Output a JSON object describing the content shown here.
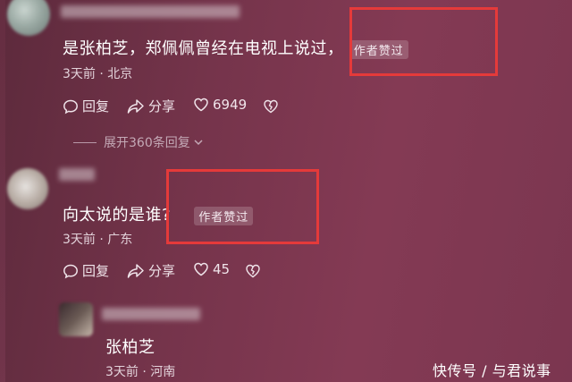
{
  "comments": [
    {
      "text": "是张柏芝，郑佩佩曾经在电视上说过，",
      "badge": "作者赞过",
      "meta": "3天前 · 北京",
      "reply_label": "回复",
      "share_label": "分享",
      "like_count": "6949",
      "expand_label": "展开360条回复"
    },
    {
      "text": "向太说的是谁?",
      "badge": "作者赞过",
      "meta": "3天前 · 广东",
      "reply_label": "回复",
      "share_label": "分享",
      "like_count": "45"
    }
  ],
  "reply": {
    "text": "张柏芝",
    "meta": "3天前 · 河南"
  },
  "watermark": "快传号 / 与君说事",
  "colors": {
    "highlight_box": "#e53a3a",
    "background": "#75344b"
  }
}
